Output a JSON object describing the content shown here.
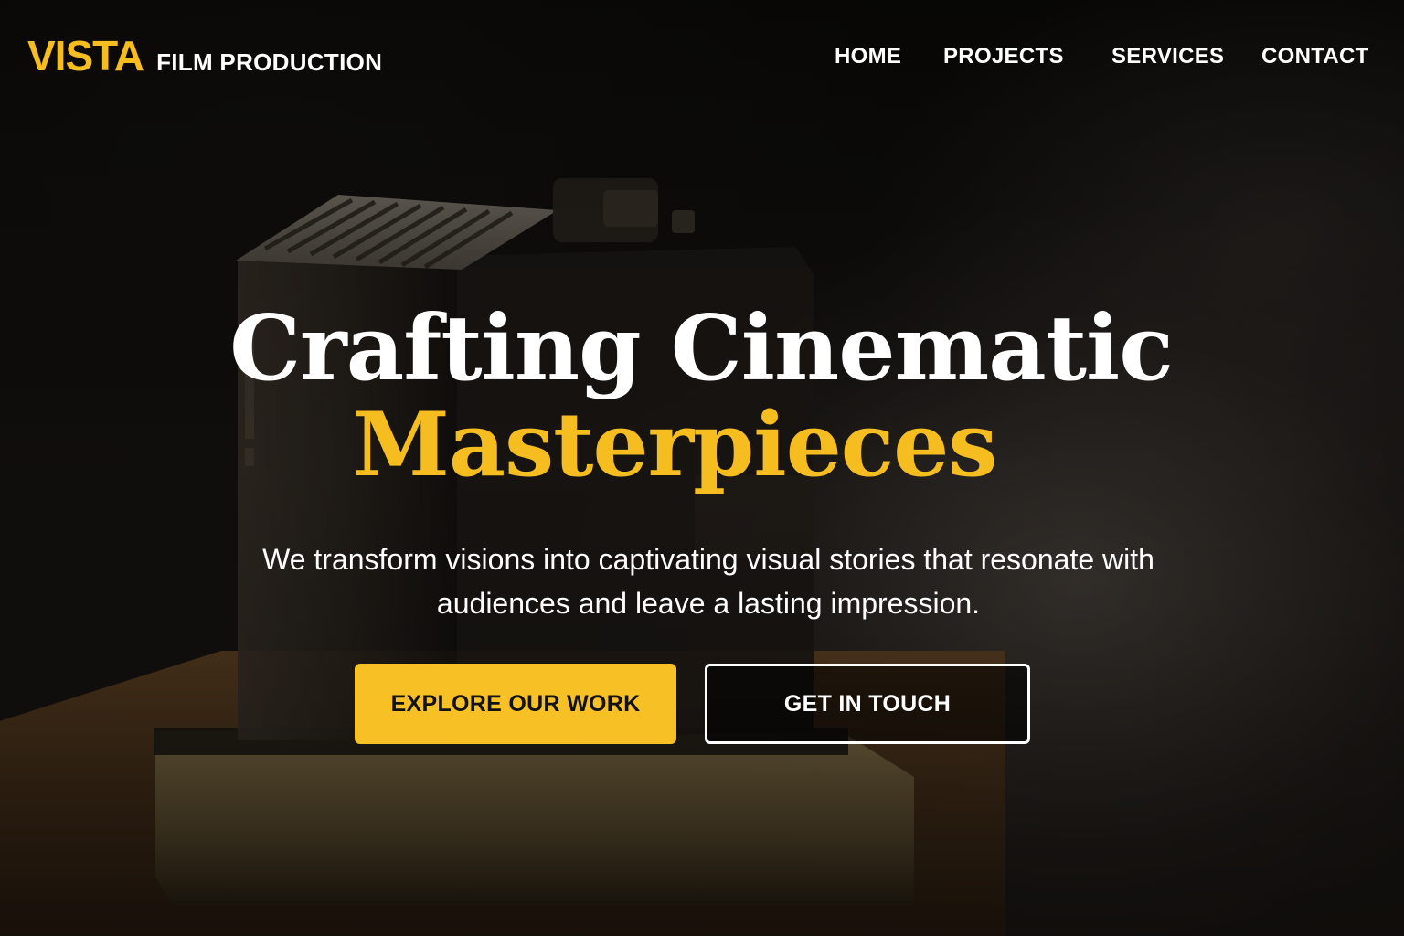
{
  "brand": {
    "name": "VISTA",
    "subtitle": "FILM PRODUCTION"
  },
  "nav": {
    "items": [
      {
        "label": "HOME"
      },
      {
        "label": "PROJECTS"
      },
      {
        "label": "SERVICES"
      },
      {
        "label": "CONTACT"
      }
    ]
  },
  "hero": {
    "headline_line1": "Crafting Cinematic",
    "headline_line2": "Masterpieces",
    "tagline": "We transform visions into captivating visual stories that resonate with audiences and leave a lasting impression.",
    "primary_button": "EXPLORE OUR WORK",
    "secondary_button": "GET IN TOUCH"
  },
  "colors": {
    "accent": "#f5bd1f",
    "text": "#ffffff",
    "background": "#0d0b09"
  }
}
